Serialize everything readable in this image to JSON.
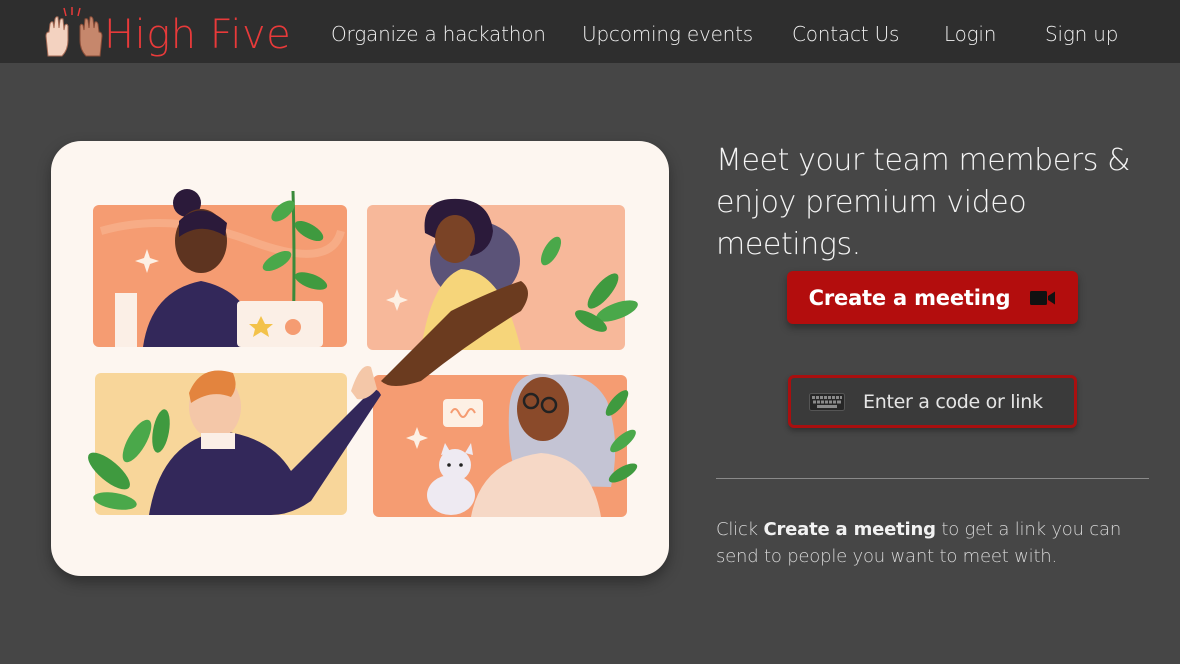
{
  "brand": {
    "name": "High Five",
    "logo_icon": "high-five-hands-icon",
    "color": "#e83a3a"
  },
  "nav": {
    "items": [
      {
        "label": "Organize a hackathon"
      },
      {
        "label": "Upcoming events"
      },
      {
        "label": "Contact Us"
      },
      {
        "label": "Login"
      },
      {
        "label": "Sign up"
      }
    ]
  },
  "hero": {
    "headline": "Meet your team members & enjoy premium video meetings.",
    "create_button": {
      "label": "Create a meeting",
      "icon": "video-camera-icon",
      "color": "#b30d0d"
    },
    "code_input": {
      "placeholder": "Enter a code or link",
      "icon": "keyboard-icon"
    },
    "hint": {
      "prefix": "Click",
      "emphasis": "Create a meeting",
      "suffix": "to get a link you can send to people you want to meet with."
    }
  },
  "illustration": {
    "icon": "video-call-grid-illustration"
  }
}
